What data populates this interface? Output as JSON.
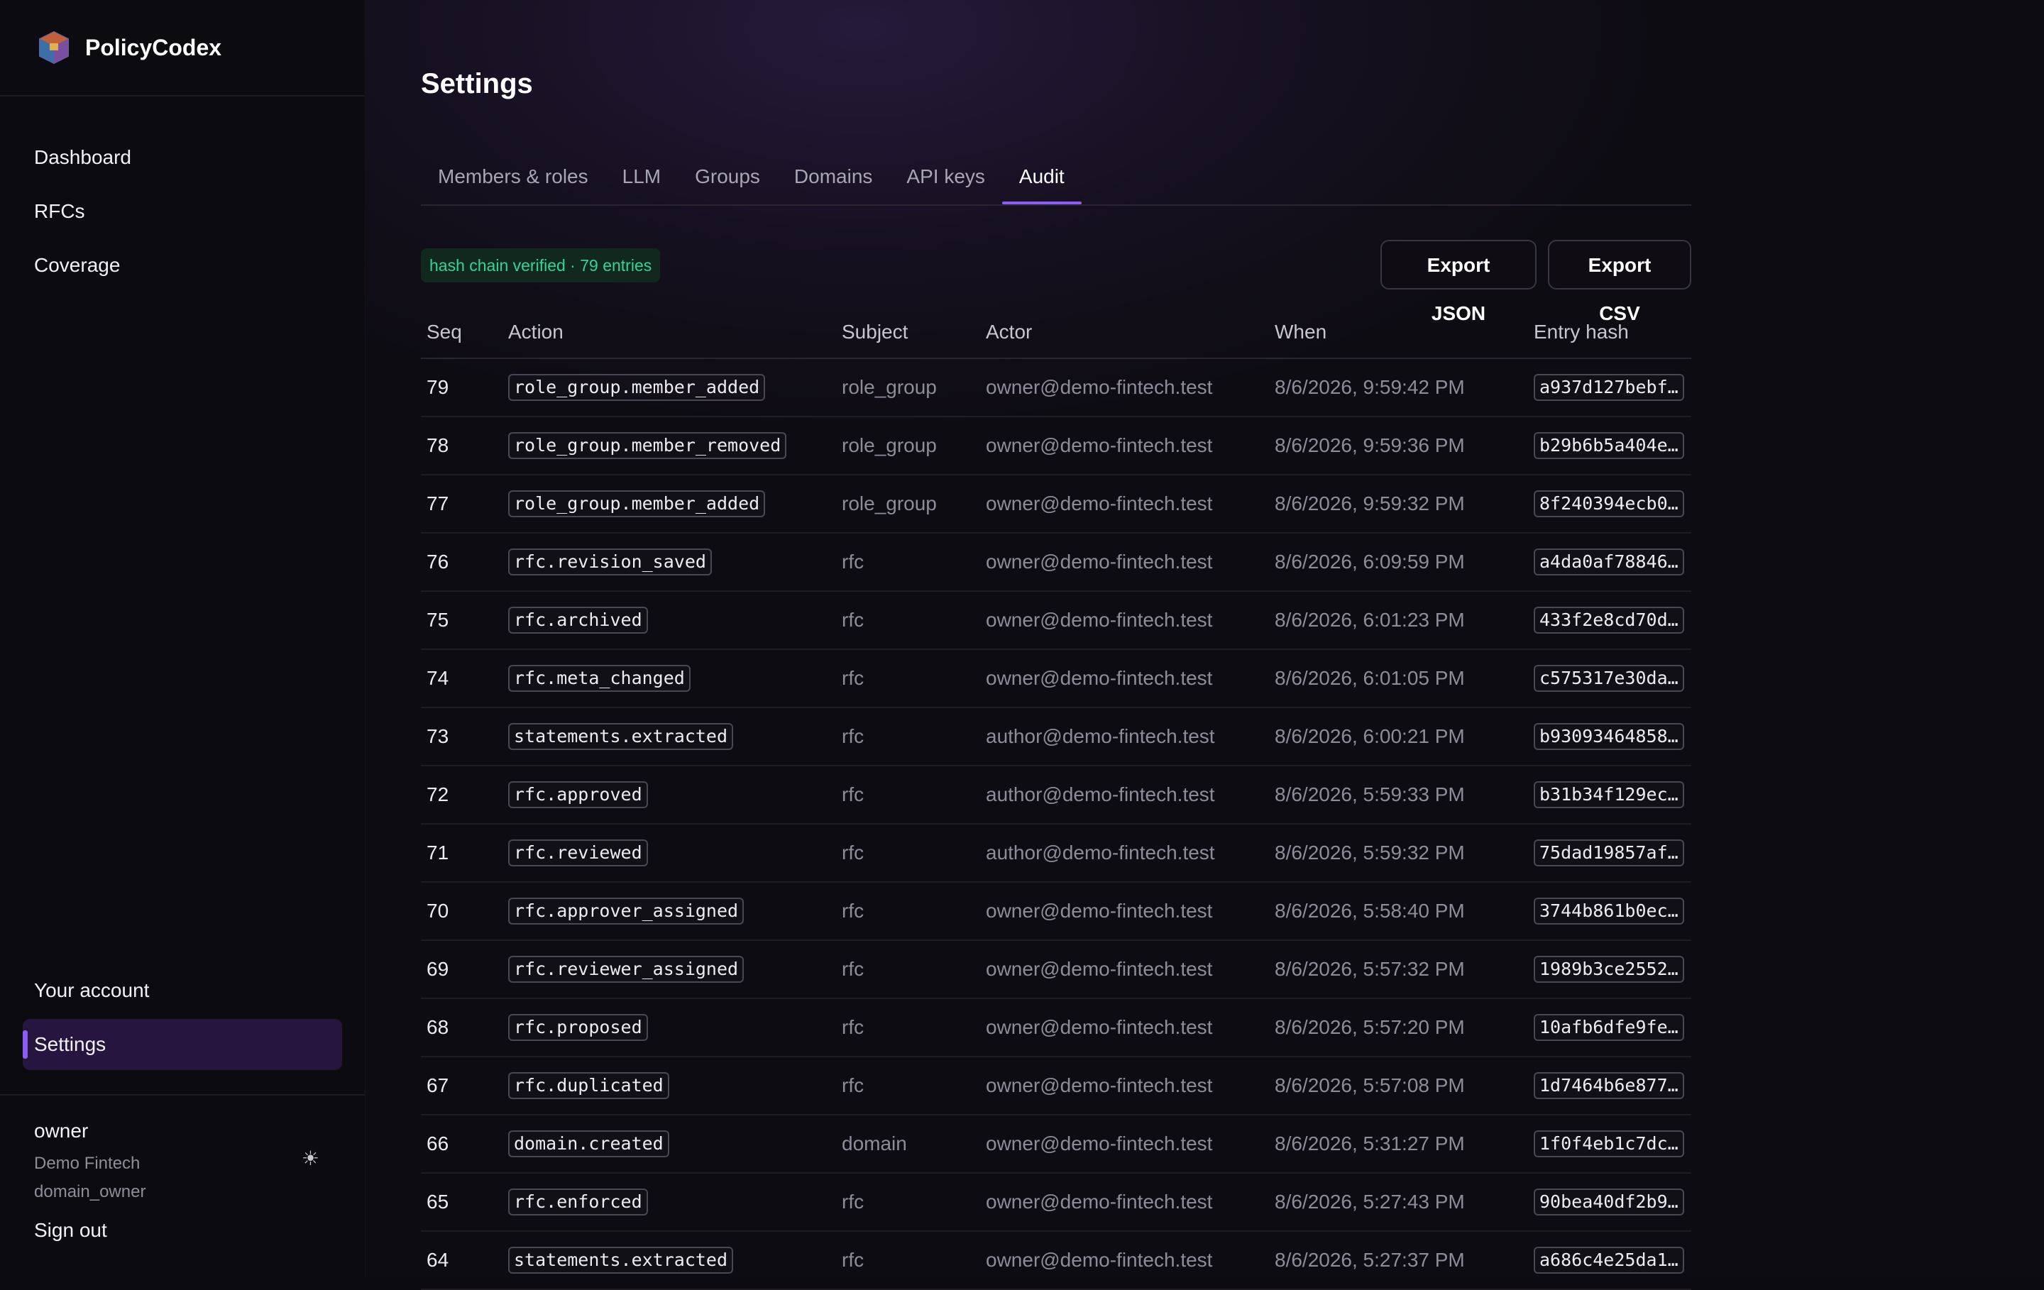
{
  "brand": {
    "name": "PolicyCodex"
  },
  "sidebar": {
    "nav": [
      "Dashboard",
      "RFCs",
      "Coverage"
    ],
    "account": "Your account",
    "settings": "Settings",
    "user": {
      "name": "owner",
      "org": "Demo Fintech",
      "role": "domain_owner"
    },
    "signout": "Sign out"
  },
  "page": {
    "title": "Settings"
  },
  "tabs": [
    "Members & roles",
    "LLM",
    "Groups",
    "Domains",
    "API keys",
    "Audit"
  ],
  "audit": {
    "badge": "hash chain verified · 79 entries",
    "export_json": "Export JSON",
    "export_csv": "Export CSV",
    "columns": [
      "Seq",
      "Action",
      "Subject",
      "Actor",
      "When",
      "Entry hash"
    ],
    "rows": [
      {
        "seq": "79",
        "action": "role_group.member_added",
        "subject": "role_group",
        "actor": "owner@demo-fintech.test",
        "when": "8/6/2026, 9:59:42 PM",
        "hash": "a937d127bebf…"
      },
      {
        "seq": "78",
        "action": "role_group.member_removed",
        "subject": "role_group",
        "actor": "owner@demo-fintech.test",
        "when": "8/6/2026, 9:59:36 PM",
        "hash": "b29b6b5a404e…"
      },
      {
        "seq": "77",
        "action": "role_group.member_added",
        "subject": "role_group",
        "actor": "owner@demo-fintech.test",
        "when": "8/6/2026, 9:59:32 PM",
        "hash": "8f240394ecb0…"
      },
      {
        "seq": "76",
        "action": "rfc.revision_saved",
        "subject": "rfc",
        "actor": "owner@demo-fintech.test",
        "when": "8/6/2026, 6:09:59 PM",
        "hash": "a4da0af78846…"
      },
      {
        "seq": "75",
        "action": "rfc.archived",
        "subject": "rfc",
        "actor": "owner@demo-fintech.test",
        "when": "8/6/2026, 6:01:23 PM",
        "hash": "433f2e8cd70d…"
      },
      {
        "seq": "74",
        "action": "rfc.meta_changed",
        "subject": "rfc",
        "actor": "owner@demo-fintech.test",
        "when": "8/6/2026, 6:01:05 PM",
        "hash": "c575317e30da…"
      },
      {
        "seq": "73",
        "action": "statements.extracted",
        "subject": "rfc",
        "actor": "author@demo-fintech.test",
        "when": "8/6/2026, 6:00:21 PM",
        "hash": "b93093464858…"
      },
      {
        "seq": "72",
        "action": "rfc.approved",
        "subject": "rfc",
        "actor": "author@demo-fintech.test",
        "when": "8/6/2026, 5:59:33 PM",
        "hash": "b31b34f129ec…"
      },
      {
        "seq": "71",
        "action": "rfc.reviewed",
        "subject": "rfc",
        "actor": "author@demo-fintech.test",
        "when": "8/6/2026, 5:59:32 PM",
        "hash": "75dad19857af…"
      },
      {
        "seq": "70",
        "action": "rfc.approver_assigned",
        "subject": "rfc",
        "actor": "owner@demo-fintech.test",
        "when": "8/6/2026, 5:58:40 PM",
        "hash": "3744b861b0ec…"
      },
      {
        "seq": "69",
        "action": "rfc.reviewer_assigned",
        "subject": "rfc",
        "actor": "owner@demo-fintech.test",
        "when": "8/6/2026, 5:57:32 PM",
        "hash": "1989b3ce2552…"
      },
      {
        "seq": "68",
        "action": "rfc.proposed",
        "subject": "rfc",
        "actor": "owner@demo-fintech.test",
        "when": "8/6/2026, 5:57:20 PM",
        "hash": "10afb6dfe9fe…"
      },
      {
        "seq": "67",
        "action": "rfc.duplicated",
        "subject": "rfc",
        "actor": "owner@demo-fintech.test",
        "when": "8/6/2026, 5:57:08 PM",
        "hash": "1d7464b6e877…"
      },
      {
        "seq": "66",
        "action": "domain.created",
        "subject": "domain",
        "actor": "owner@demo-fintech.test",
        "when": "8/6/2026, 5:31:27 PM",
        "hash": "1f0f4eb1c7dc…"
      },
      {
        "seq": "65",
        "action": "rfc.enforced",
        "subject": "rfc",
        "actor": "owner@demo-fintech.test",
        "when": "8/6/2026, 5:27:43 PM",
        "hash": "90bea40df2b9…"
      },
      {
        "seq": "64",
        "action": "statements.extracted",
        "subject": "rfc",
        "actor": "owner@demo-fintech.test",
        "when": "8/6/2026, 5:27:37 PM",
        "hash": "a686c4e25da1…"
      }
    ]
  }
}
